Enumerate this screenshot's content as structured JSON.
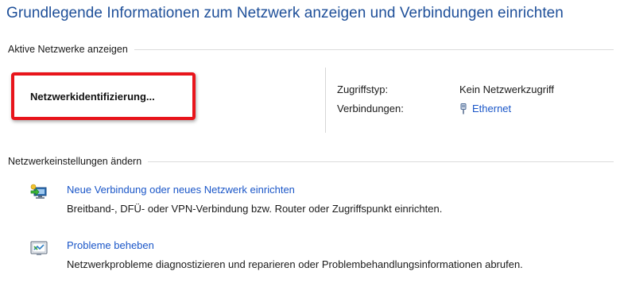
{
  "page_title": "Grundlegende Informationen zum Netzwerk anzeigen und Verbindungen einrichten",
  "active_networks": {
    "header": "Aktive Netzwerke anzeigen",
    "network_name": "Netzwerkidentifizierung...",
    "access_type_label": "Zugriffstyp:",
    "access_type_value": "Kein Netzwerkzugriff",
    "connections_label": "Verbindungen:",
    "connections_value": "Ethernet",
    "connections_icon": "ethernet-icon"
  },
  "settings": {
    "header": "Netzwerkeinstellungen ändern",
    "tasks": [
      {
        "icon": "new-connection-icon",
        "link": "Neue Verbindung oder neues Netzwerk einrichten",
        "description": "Breitband-, DFÜ- oder VPN-Verbindung bzw. Router oder Zugriffspunkt einrichten."
      },
      {
        "icon": "troubleshoot-icon",
        "link": "Probleme beheben",
        "description": "Netzwerkprobleme diagnostizieren und reparieren oder Problembehandlungsinformationen abrufen."
      }
    ]
  },
  "colors": {
    "title": "#1e4f99",
    "link": "#1a56c8",
    "highlight_border": "#e8141b"
  }
}
